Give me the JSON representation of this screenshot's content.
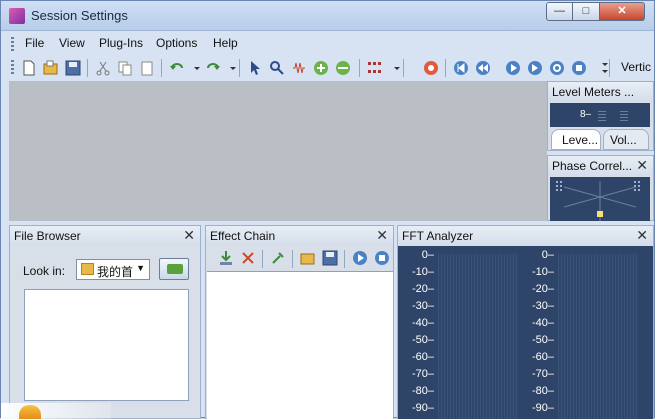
{
  "window": {
    "title": "Session Settings"
  },
  "caption_buttons": {
    "minimize": "—",
    "maximize": "□",
    "close": "✕"
  },
  "menu": [
    "File",
    "View",
    "Plug-Ins",
    "Options",
    "Help"
  ],
  "toolbar": {
    "overflow_label": "Vertic"
  },
  "panels": {
    "level_meters": {
      "title": "Level Meters ...",
      "mark": "8–",
      "tabs": [
        "Leve...",
        "Vol..."
      ]
    },
    "phase_correlation": {
      "title": "Phase Correl..."
    },
    "file_browser": {
      "title": "File Browser",
      "look_in_label": "Look in:",
      "look_in_value": "我的首"
    },
    "effect_chain": {
      "title": "Effect Chain"
    },
    "fft_analyzer": {
      "title": "FFT Analyzer",
      "labels": [
        "0–",
        "-10–",
        "-20–",
        "-30–",
        "-40–",
        "-50–",
        "-60–",
        "-70–",
        "-80–",
        "-90–"
      ]
    }
  },
  "colors": {
    "meter_background": "#2e4569",
    "workspace": "#babfc6",
    "titlebar": "#b8cde9"
  }
}
